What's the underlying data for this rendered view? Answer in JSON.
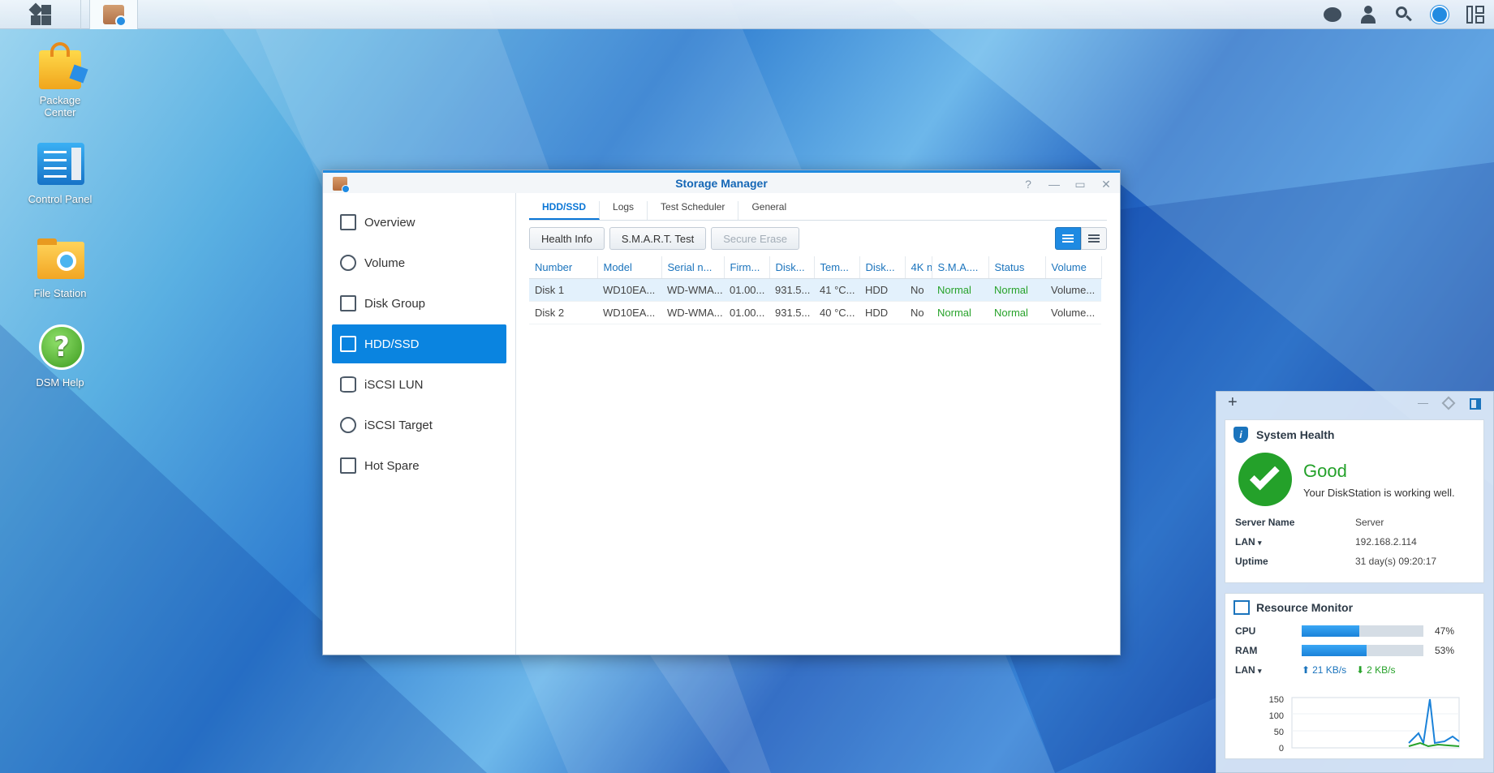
{
  "desktop": {
    "icons": [
      {
        "label": "Package\nCenter",
        "icon": "shopping-bag-icon"
      },
      {
        "label": "Control Panel",
        "icon": "control-panel-icon"
      },
      {
        "label": "File Station",
        "icon": "folder-search-icon"
      },
      {
        "label": "DSM Help",
        "icon": "help-icon"
      }
    ]
  },
  "taskbar": {
    "left_icons": [
      "apps-grid-icon",
      "storage-manager-icon"
    ],
    "right_icons": [
      "chat-icon",
      "user-icon",
      "search-icon",
      "options-icon",
      "widgets-icon"
    ]
  },
  "window": {
    "title": "Storage Manager",
    "controls": [
      "?",
      "—",
      "▭",
      "✕"
    ],
    "sidebar": [
      {
        "label": "Overview",
        "icon": "overview-icon",
        "active": false
      },
      {
        "label": "Volume",
        "icon": "volume-icon",
        "active": false
      },
      {
        "label": "Disk Group",
        "icon": "disk-group-icon",
        "active": false
      },
      {
        "label": "HDD/SSD",
        "icon": "hdd-icon",
        "active": true
      },
      {
        "label": "iSCSI LUN",
        "icon": "lun-icon",
        "active": false
      },
      {
        "label": "iSCSI Target",
        "icon": "target-icon",
        "active": false
      },
      {
        "label": "Hot Spare",
        "icon": "hot-spare-icon",
        "active": false
      }
    ],
    "tabs": [
      {
        "label": "HDD/SSD",
        "active": true
      },
      {
        "label": "Logs",
        "active": false
      },
      {
        "label": "Test Scheduler",
        "active": false
      },
      {
        "label": "General",
        "active": false
      }
    ],
    "toolbar": {
      "health_info": "Health Info",
      "smart_test": "S.M.A.R.T. Test",
      "secure_erase": "Secure Erase"
    },
    "table": {
      "columns": [
        "Number",
        "Model",
        "Serial n...",
        "Firm...",
        "Disk...",
        "Tem...",
        "Disk...",
        "4K n",
        "S.M.A....",
        "Status",
        "Volume"
      ],
      "rows": [
        [
          "Disk 1",
          "WD10EA...",
          "WD-WMA...",
          "01.00...",
          "931.5...",
          "41 °C...",
          "HDD",
          "No",
          "Normal",
          "Normal",
          "Volume..."
        ],
        [
          "Disk 2",
          "WD10EA...",
          "WD-WMA...",
          "01.00...",
          "931.5...",
          "40 °C...",
          "HDD",
          "No",
          "Normal",
          "Normal",
          "Volume..."
        ]
      ]
    }
  },
  "widgets": {
    "header": {
      "add": "+",
      "minimize": "—"
    },
    "health": {
      "title": "System Health",
      "status": "Good",
      "message": "Your DiskStation is working well.",
      "server_name_label": "Server Name",
      "server_name": "Server",
      "lan_label": "LAN",
      "lan_ip": "192.168.2.114",
      "uptime_label": "Uptime",
      "uptime": "31 day(s) 09:20:17"
    },
    "resource": {
      "title": "Resource Monitor",
      "cpu_label": "CPU",
      "cpu_percent": 47,
      "cpu_text": "47%",
      "ram_label": "RAM",
      "ram_percent": 53,
      "ram_text": "53%",
      "lan_label": "LAN",
      "upload": "21 KB/s",
      "download": "2 KB/s",
      "y_ticks": [
        "150",
        "100",
        "50",
        "0"
      ]
    }
  },
  "colors": {
    "accent": "#0a84e0",
    "ok_green": "#27a22a",
    "header_blue": "#1b74bd"
  }
}
